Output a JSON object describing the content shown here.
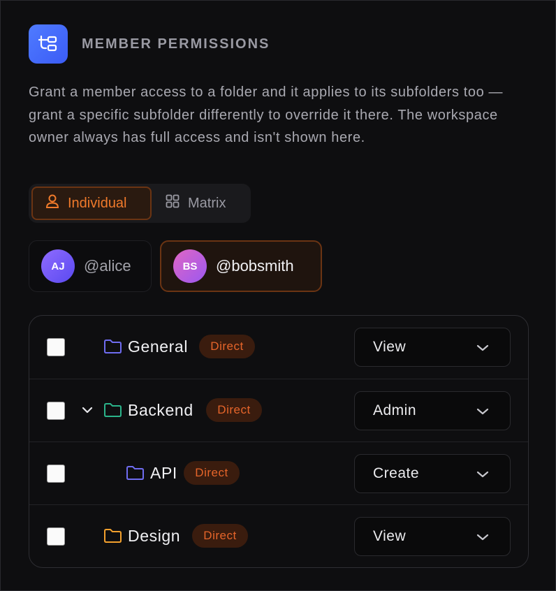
{
  "header": {
    "title": "MEMBER PERMISSIONS",
    "logo_icon": "folder-tree-icon"
  },
  "description": "Grant a member access to a folder and it applies to its subfolders too — grant a specific subfolder differently to override it there. The workspace owner always has full access and isn't shown here.",
  "view_toggle": {
    "individual_label": "Individual",
    "matrix_label": "Matrix",
    "selected": "Individual"
  },
  "members": [
    {
      "initials": "AJ",
      "handle": "@alice",
      "selected": false
    },
    {
      "initials": "BS",
      "handle": "@bobsmith",
      "selected": true
    }
  ],
  "folders": [
    {
      "name": "General",
      "badge": "Direct",
      "permission": "View",
      "color": "#6f6cf0",
      "depth": 0
    },
    {
      "name": "Backend",
      "badge": "Direct",
      "permission": "Admin",
      "color": "#2bb38a",
      "depth": 0,
      "expanded": true
    },
    {
      "name": "API",
      "badge": "Direct",
      "permission": "Create",
      "color": "#6f6cf0",
      "depth": 1
    },
    {
      "name": "Design",
      "badge": "Direct",
      "permission": "View",
      "color": "#f2a02d",
      "depth": 0
    }
  ],
  "colors": {
    "accent": "#f07a2b",
    "badge_bg": "#3a1c0e",
    "logo": "#4f7bff"
  }
}
